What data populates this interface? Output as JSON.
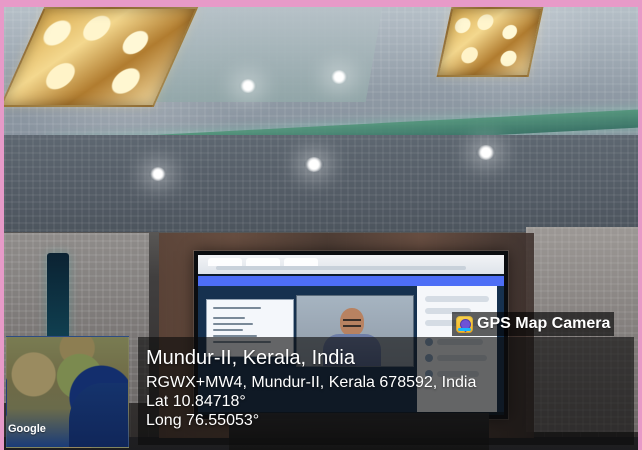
{
  "overlay": {
    "app_label": "GPS Map Camera",
    "location_title": "Mundur-II, Kerala, India",
    "address": "RGWX+MW4, Mundur-II, Kerala 678592, India",
    "latitude": "Lat 10.84718°",
    "longitude": "Long 76.55053°"
  },
  "map": {
    "label": "Google"
  },
  "colors": {
    "border": "#e79ac8",
    "overlay": "#0c0c0c",
    "ceiling_accent": "#4d9678",
    "screen_accent": "#4d6ef6",
    "map_water": "#132e6d"
  },
  "icons": {
    "app": "gps-map-camera-icon"
  }
}
